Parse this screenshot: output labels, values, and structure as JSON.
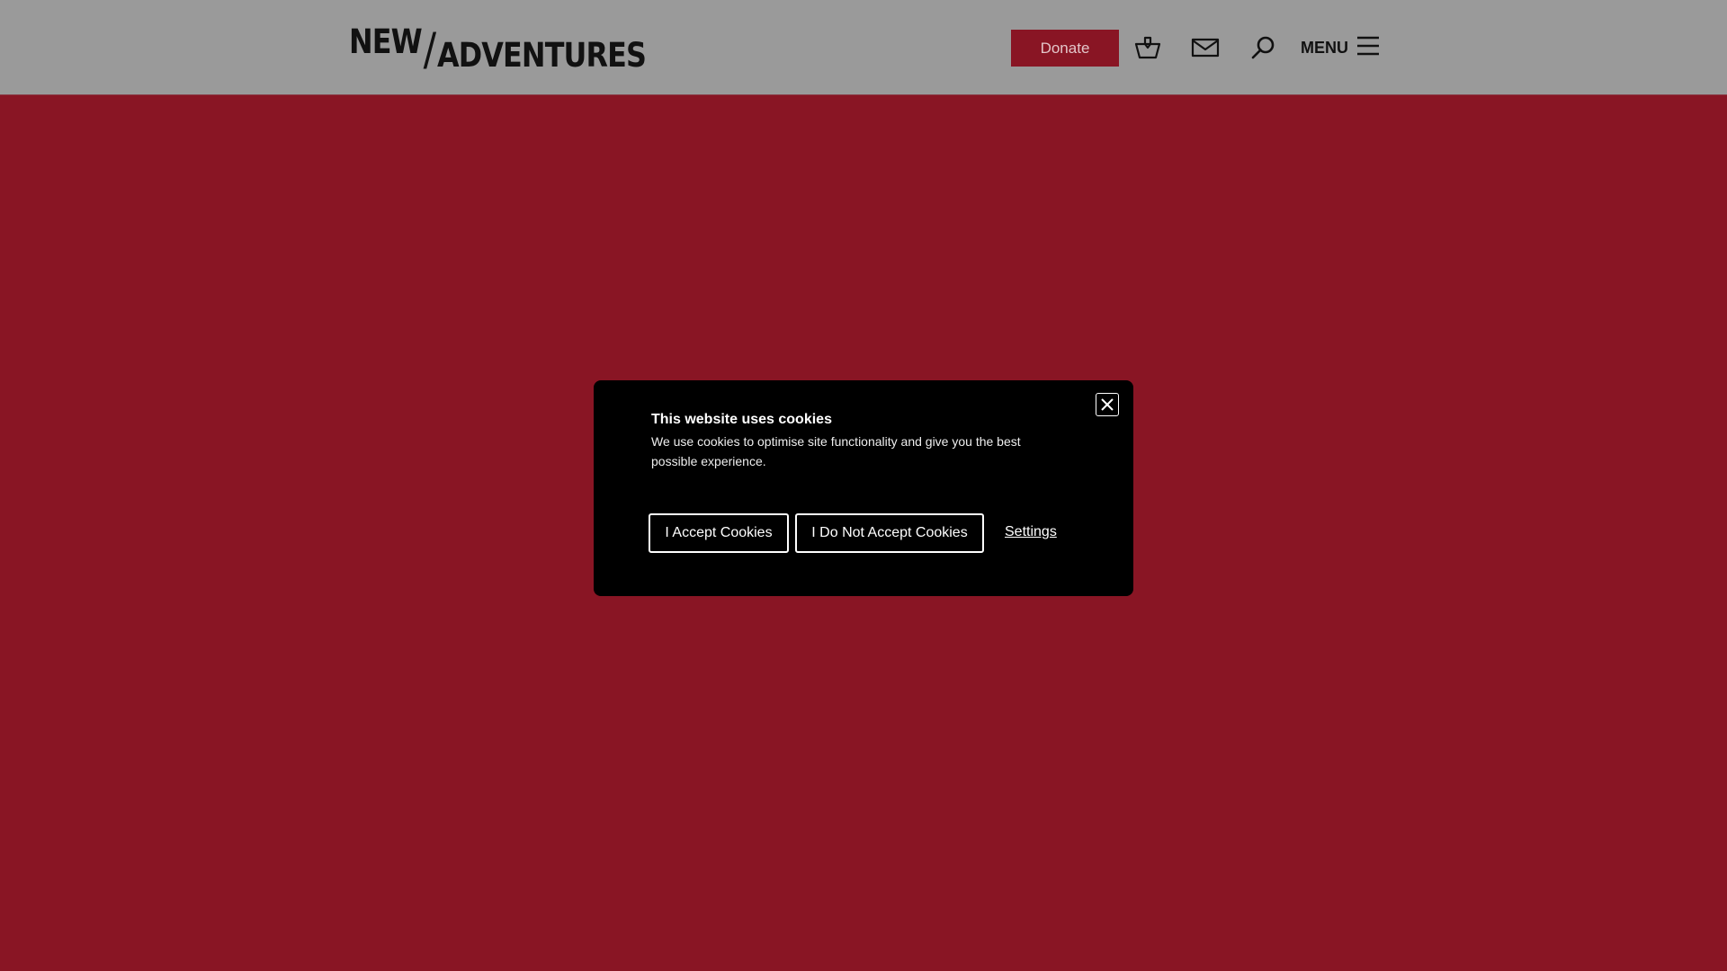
{
  "header": {
    "logo": {
      "part1": "NEW",
      "slash": "/",
      "part2": "ADVENTURES"
    },
    "donate_label": "Donate",
    "menu_label": "MENU",
    "icons": {
      "basket": "basket-icon",
      "mail": "mail-icon",
      "search": "search-icon",
      "menu": "hamburger-icon"
    }
  },
  "cookie_banner": {
    "title": "This website uses cookies",
    "text": "We use cookies to optimise site functionality and give you the best possible experience.",
    "accept_label": "I Accept Cookies",
    "reject_label": "I Do Not Accept Cookies",
    "settings_label": "Settings",
    "close_icon": "close-icon"
  },
  "colors": {
    "page_background": "#891524",
    "header_background": "#9a9a9a",
    "donate_background": "#891524",
    "modal_background": "#000000"
  }
}
